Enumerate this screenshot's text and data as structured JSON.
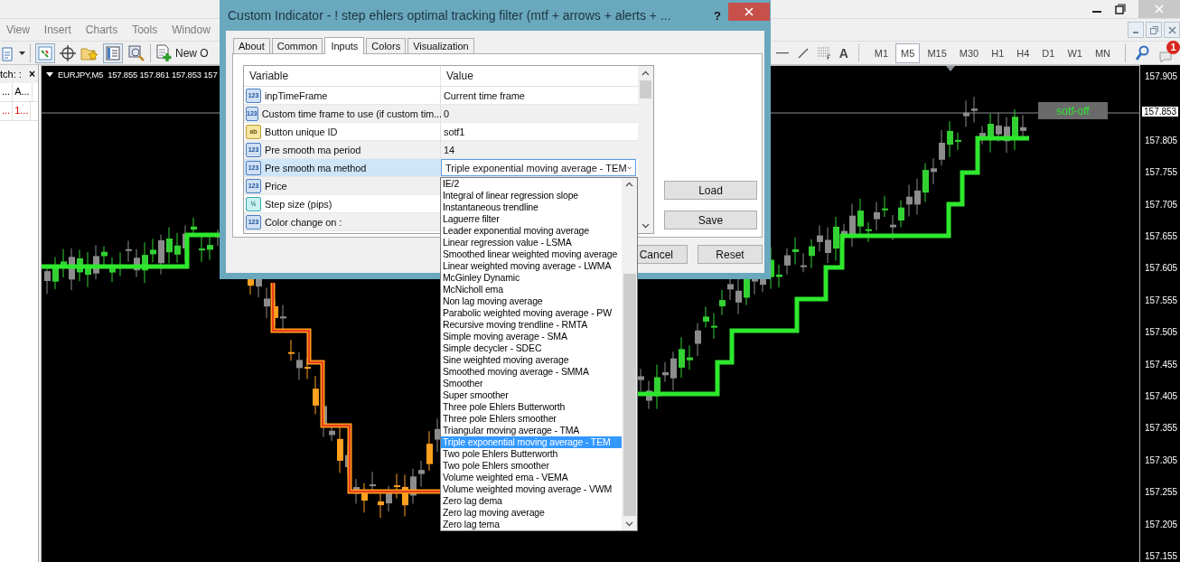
{
  "menu": [
    {
      "label": "View"
    },
    {
      "label": "Insert"
    },
    {
      "label": "Charts"
    },
    {
      "label": "Tools"
    },
    {
      "label": "Window"
    }
  ],
  "toolbar": {
    "new_order": "New O",
    "text_tool": "A",
    "timeframes": [
      {
        "label": "M1",
        "selected": false
      },
      {
        "label": "M5",
        "selected": true
      },
      {
        "label": "M15",
        "selected": false
      },
      {
        "label": "M30",
        "selected": false
      },
      {
        "label": "H1",
        "selected": false
      },
      {
        "label": "H4",
        "selected": false
      },
      {
        "label": "D1",
        "selected": false
      },
      {
        "label": "W1",
        "selected": false
      },
      {
        "label": "MN",
        "selected": false
      }
    ],
    "notification_count": "1"
  },
  "market_watch": {
    "title": "tch: :",
    "close": "×",
    "rows": [
      {
        "cells": [
          "...",
          "A..."
        ],
        "color": "#000000"
      },
      {
        "cells": [
          "...",
          "1..."
        ],
        "color": "#e00000"
      }
    ]
  },
  "chart": {
    "symbol_line": "EURJPY,M5  157.855 157.861 157.853 157",
    "current_price": "157.853",
    "toggle_button": "sotf-off",
    "price_labels": [
      "157.905",
      "157.805",
      "157.755",
      "157.705",
      "157.655",
      "157.605",
      "157.555",
      "157.505",
      "157.455",
      "157.405",
      "157.355",
      "157.305",
      "157.255",
      "157.205",
      "157.155"
    ]
  },
  "dialog": {
    "title": "Custom Indicator - ! step ehlers optimal tracking  filter (mtf + arrows + alerts + ...",
    "help": "?",
    "tabs": [
      {
        "label": "About",
        "selected": false
      },
      {
        "label": "Common",
        "selected": false
      },
      {
        "label": "Inputs",
        "selected": true
      },
      {
        "label": "Colors",
        "selected": false
      },
      {
        "label": "Visualization",
        "selected": false
      }
    ],
    "columns": [
      "Variable",
      "Value"
    ],
    "rows": [
      {
        "kind": "int",
        "badge": "123",
        "variable": "inpTimeFrame",
        "value": "Current time frame",
        "selected": false
      },
      {
        "kind": "int",
        "badge": "123",
        "variable": "Custom time frame to use (if custom tim...",
        "value": "0",
        "selected": false
      },
      {
        "kind": "string",
        "badge": "ab",
        "variable": "Button unique ID",
        "value": "sotf1",
        "selected": false
      },
      {
        "kind": "int",
        "badge": "123",
        "variable": "Pre smooth ma period",
        "value": "14",
        "selected": false
      },
      {
        "kind": "int",
        "badge": "123",
        "variable": "Pre smooth ma method",
        "value": "Triple exponential moving average - TEM",
        "selected": true
      },
      {
        "kind": "int",
        "badge": "123",
        "variable": "Price",
        "selected": false
      },
      {
        "kind": "double",
        "badge": "½",
        "variable": "Step size (pips)",
        "selected": false
      },
      {
        "kind": "int",
        "badge": "123",
        "variable": "Color change on :",
        "selected": false
      }
    ],
    "side_buttons": [
      "Load",
      "Save"
    ],
    "bottom_buttons": [
      "Cancel",
      "Reset"
    ]
  },
  "dropdown": {
    "items": [
      {
        "label": "IE/2",
        "selected": false
      },
      {
        "label": "Integral of linear regression slope",
        "selected": false
      },
      {
        "label": "Instantaneous trendline",
        "selected": false
      },
      {
        "label": "Laguerre filter",
        "selected": false
      },
      {
        "label": "Leader exponential moving average",
        "selected": false
      },
      {
        "label": "Linear regression value - LSMA",
        "selected": false
      },
      {
        "label": "Smoothed linear weighted moving average",
        "selected": false
      },
      {
        "label": "Linear weighted moving average - LWMA",
        "selected": false
      },
      {
        "label": "McGinley Dynamic",
        "selected": false
      },
      {
        "label": "McNicholl ema",
        "selected": false
      },
      {
        "label": "Non lag moving average",
        "selected": false
      },
      {
        "label": "Parabolic weighted moving average - PW",
        "selected": false
      },
      {
        "label": "Recursive moving trendline - RMTA",
        "selected": false
      },
      {
        "label": "Simple moving average - SMA",
        "selected": false
      },
      {
        "label": "Simple decycler - SDEC",
        "selected": false
      },
      {
        "label": "Sine weighted moving average",
        "selected": false
      },
      {
        "label": "Smoothed moving average - SMMA",
        "selected": false
      },
      {
        "label": "Smoother",
        "selected": false
      },
      {
        "label": "Super smoother",
        "selected": false
      },
      {
        "label": "Three pole Ehlers Butterworth",
        "selected": false
      },
      {
        "label": "Three pole Ehlers smoother",
        "selected": false
      },
      {
        "label": "Triangular moving average - TMA",
        "selected": false
      },
      {
        "label": "Triple exponential moving average - TEM",
        "selected": true
      },
      {
        "label": "Two pole Ehlers Butterworth",
        "selected": false
      },
      {
        "label": "Two pole Ehlers smoother",
        "selected": false
      },
      {
        "label": "Volume weighted ema - VEMA",
        "selected": false
      },
      {
        "label": "Volume weighted moving average - VWM",
        "selected": false
      },
      {
        "label": "Zero lag dema",
        "selected": false
      },
      {
        "label": "Zero lag moving average",
        "selected": false
      },
      {
        "label": "Zero lag tema",
        "selected": false
      }
    ]
  }
}
